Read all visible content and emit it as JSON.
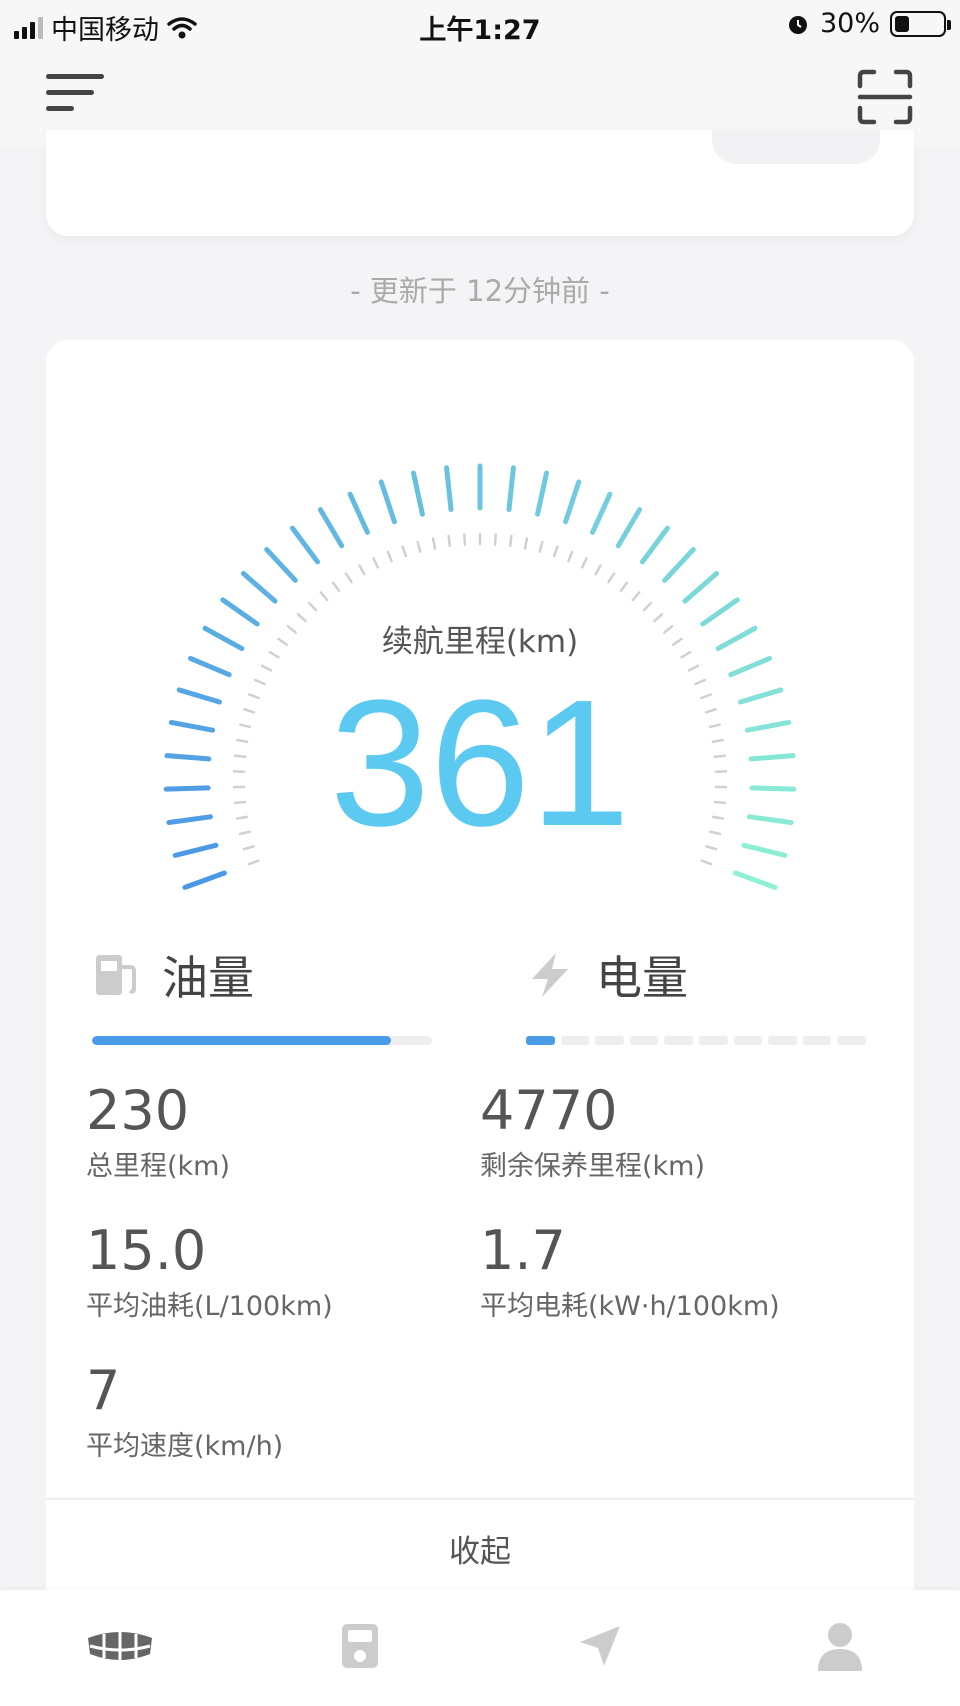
{
  "status_bar": {
    "carrier": "中国移动",
    "time": "上午1:27",
    "battery_percent": "30%",
    "battery_level": 0.3
  },
  "nav": {
    "menu_icon": "hamburger-menu-icon",
    "scan_icon": "scan-icon"
  },
  "summary": {
    "updated_text": "- 更新于 12分钟前 -"
  },
  "range_gauge": {
    "label": "续航里程(km)",
    "value": "361",
    "colors": {
      "start": "#4a98e6",
      "end": "#8ef0d4",
      "inner": "#d0d0d0"
    }
  },
  "fuel": {
    "icon": "fuel-pump-icon",
    "title": "油量",
    "level": 0.88,
    "bar_color": "#4a9be8"
  },
  "electric": {
    "icon": "lightning-icon",
    "title": "电量",
    "segments_total": 10,
    "segments_on": 1,
    "bar_color": "#4a9be8"
  },
  "stats": [
    {
      "value": "230",
      "label": "总里程(km)"
    },
    {
      "value": "4770",
      "label": "剩余保养里程(km)"
    },
    {
      "value": "15.0",
      "label": "平均油耗(L/100km)"
    },
    {
      "value": "1.7",
      "label": "平均电耗(kW·h/100km)"
    },
    {
      "value": "7",
      "label": "平均速度(km/h)"
    }
  ],
  "collapse_label": "收起",
  "tab_bar": {
    "items": [
      {
        "icon": "car-brand-icon",
        "active": true
      },
      {
        "icon": "charger-icon",
        "active": false
      },
      {
        "icon": "navigation-icon",
        "active": false
      },
      {
        "icon": "profile-icon",
        "active": false
      }
    ]
  }
}
